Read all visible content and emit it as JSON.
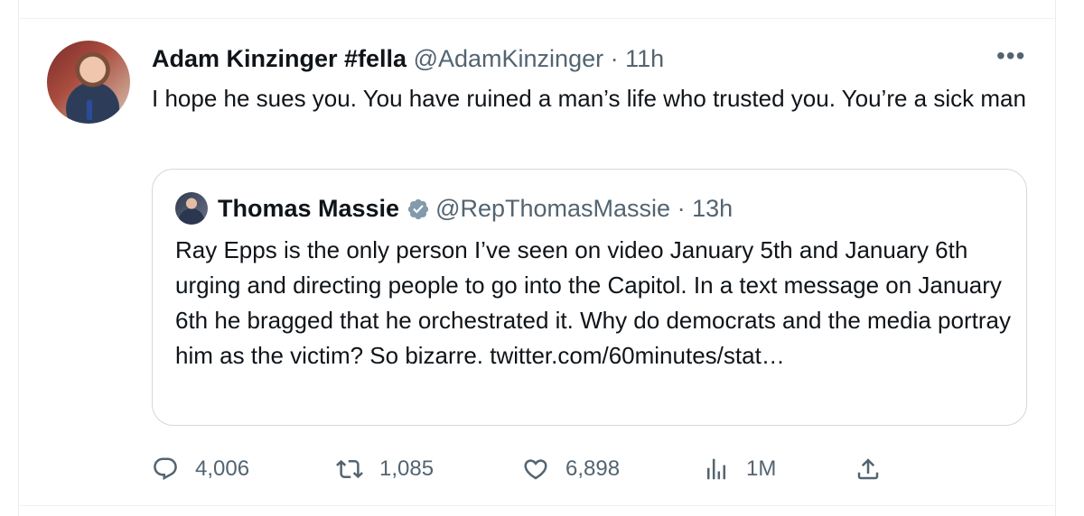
{
  "tweet": {
    "author_name": "Adam Kinzinger #fella",
    "author_handle": "@AdamKinzinger",
    "separator": "·",
    "time": "11h",
    "more_label": "•••",
    "text": "I hope he sues you.  You have ruined a man’s life who trusted you.  You’re a sick man"
  },
  "quote": {
    "author_name": "Thomas Massie",
    "author_handle": "@RepThomasMassie",
    "separator": "·",
    "time": "13h",
    "text": "Ray Epps is the only person I’ve seen on video January 5th and January 6th urging and directing people to go into the Capitol. In a text message on January 6th he bragged that he orchestrated it. Why do democrats and the media portray him as the victim? So bizarre. twitter.com/60minutes/stat…",
    "verified_icon": "verified-badge-icon",
    "verified_color": "#829aab"
  },
  "actions": {
    "replies": "4,006",
    "retweets": "1,085",
    "likes": "6,898",
    "views": "1M"
  },
  "colors": {
    "text": "#0f1419",
    "muted": "#536471",
    "border": "#cfd9de"
  }
}
